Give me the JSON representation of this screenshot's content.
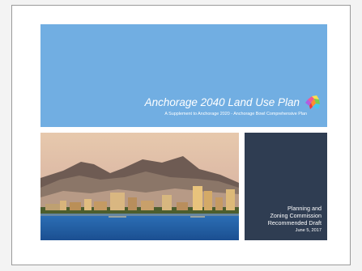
{
  "document": {
    "title": "Anchorage 2040 Land Use Plan",
    "subtitle": "A Supplement to Anchorage 2020 - Anchorage Bowl Comprehensive Plan",
    "logo_icon": "colorful-puzzle-state-map-icon",
    "photo_icon": "anchorage-skyline-photo",
    "draft_lines": [
      "Planning and",
      "Zoning Commission",
      "Recommended  Draft"
    ],
    "date": "June 5, 2017",
    "colors": {
      "banner": "#71aee2",
      "draft_box": "#2f3d52",
      "text": "#ffffff"
    }
  }
}
